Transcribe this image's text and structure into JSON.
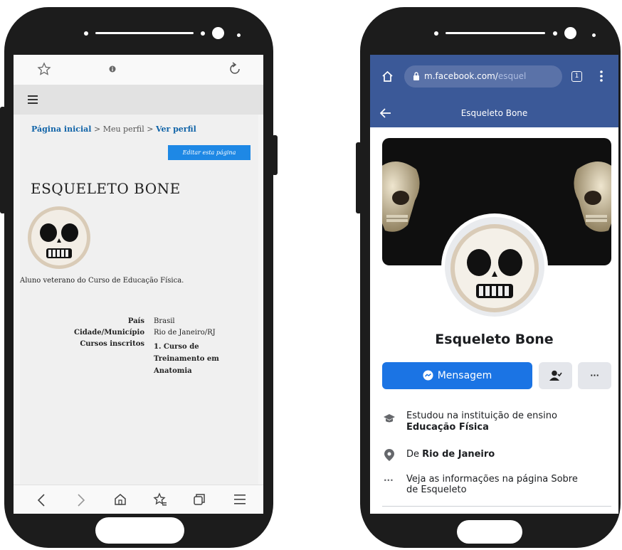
{
  "left_phone": {
    "breadcrumb": {
      "home": "Página inicial",
      "separator": ">",
      "profile": "Meu perfil",
      "view_profile": "Ver perfil"
    },
    "edit_button": "Editar esta página",
    "title": "ESQUELETO BONE",
    "description": "Aluno veterano do Curso de Educação Física.",
    "details": {
      "country_label": "País",
      "country_value": "Brasil",
      "city_label": "Cidade/Município",
      "city_value": "Rio de Janeiro/RJ",
      "courses_label": "Cursos inscritos",
      "course_line1": "1. Curso de",
      "course_line2": "Treinamento em",
      "course_line3": "Anatomia"
    },
    "icons": [
      "star-icon",
      "info-icon",
      "reload-icon",
      "menu-icon",
      "back-icon",
      "forward-icon",
      "home-icon",
      "bookmarks-icon",
      "tabs-icon",
      "more-menu-icon"
    ]
  },
  "right_phone": {
    "url_main": "m.facebook.com/",
    "url_dim": "esquel",
    "tab_count": "1",
    "page_title": "Esqueleto Bone",
    "profile_name": "Esqueleto Bone",
    "message_button": "Mensagem",
    "more_label": "···",
    "info": {
      "studied_prefix": "Estudou na instituição de ensino",
      "studied_value": "Educação Física",
      "from_prefix": "De",
      "from_value": "Rio de Janeiro",
      "about_line1": "Veja as informações na página Sobre",
      "about_line2": "de Esqueleto"
    },
    "colors": {
      "facebook_blue": "#3b5998",
      "button_blue": "#1b74e4",
      "moodle_link": "#1164a8"
    }
  }
}
